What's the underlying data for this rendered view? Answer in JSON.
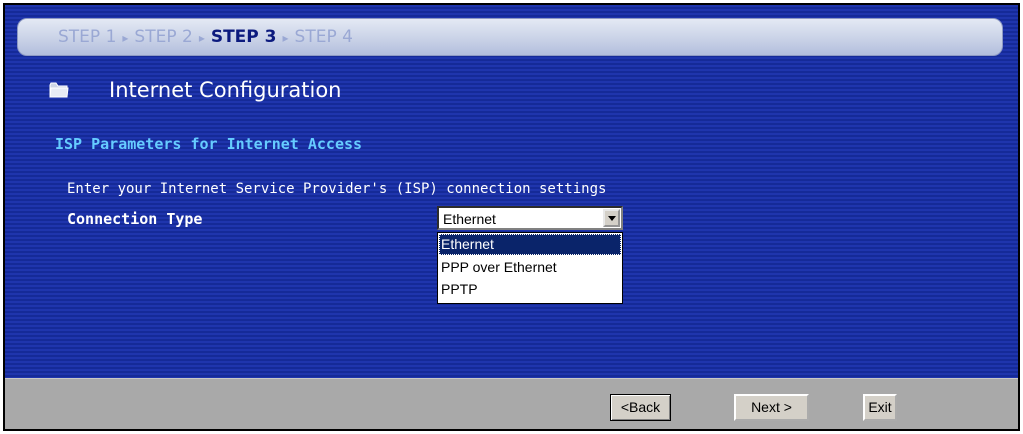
{
  "wizard": {
    "steps": [
      "STEP 1",
      "STEP 2",
      "STEP 3",
      "STEP 4"
    ],
    "active_step": "STEP 3"
  },
  "page": {
    "title": "Internet Configuration",
    "section_title": "ISP Parameters for Internet Access",
    "instructions": "Enter your Internet Service Provider's (ISP) connection settings"
  },
  "connection_type": {
    "label": "Connection Type",
    "selected": "Ethernet",
    "options": [
      "Ethernet",
      "PPP over Ethernet",
      "PPTP"
    ]
  },
  "buttons": {
    "back": "<Back",
    "next": "Next >",
    "exit": "Exit"
  },
  "icons": {
    "title_icon": "folder-icon",
    "dropdown_icon": "chevron-down-icon"
  },
  "colors": {
    "panel_blue": "#1a2fa3",
    "section_title": "#66ccff",
    "footer_gray": "#a9a9a9",
    "selection": "#0a246a"
  }
}
